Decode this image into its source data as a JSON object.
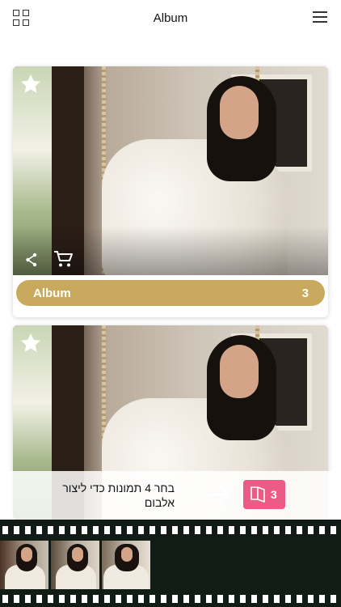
{
  "header": {
    "title": "Album",
    "left_icon": "grid-icon",
    "right_icon": "hamburger-menu-icon"
  },
  "cards": [
    {
      "favorite_icon": "star-icon",
      "share_icon": "share-icon",
      "cart_icon": "cart-icon",
      "album_label": "Album",
      "album_count": "3"
    },
    {
      "favorite_icon": "star-icon"
    }
  ],
  "bottom_bar": {
    "hint_text": "בחר 4 תמונות  כדי ליצור אלבום",
    "next_icon": "arrow-right-icon",
    "album_icon": "book-icon",
    "selected_count": "3"
  },
  "filmstrip": {
    "thumbnails": [
      {
        "name": "thumb-1"
      },
      {
        "name": "thumb-2"
      },
      {
        "name": "thumb-3"
      }
    ]
  },
  "colors": {
    "accent_gold": "#c8a95e",
    "badge_pink": "#ec5a86",
    "film_background": "#111c17"
  }
}
